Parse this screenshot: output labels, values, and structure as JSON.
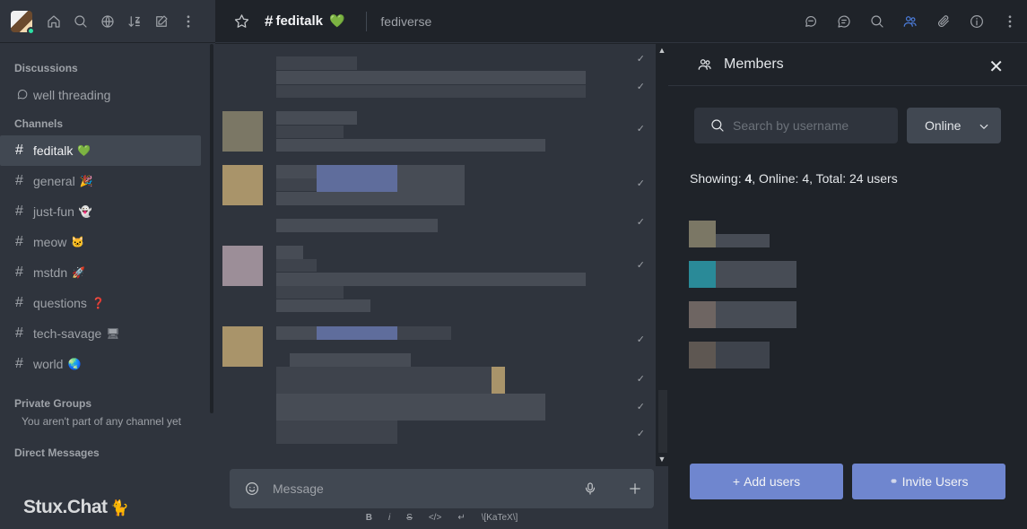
{
  "sidebar": {
    "sections": {
      "discussions": "Discussions",
      "channels": "Channels",
      "private_groups": "Private Groups",
      "direct_messages": "Direct Messages"
    },
    "discussion_item": "well threading",
    "channels": [
      {
        "label": "feditalk",
        "emoji": "💚",
        "active": true
      },
      {
        "label": "general",
        "emoji": "🎉"
      },
      {
        "label": "just-fun",
        "emoji": "👻"
      },
      {
        "label": "meow",
        "emoji": "🐱"
      },
      {
        "label": "mstdn",
        "emoji": "🚀"
      },
      {
        "label": "questions",
        "emoji": "❓"
      },
      {
        "label": "tech-savage",
        "emoji": "🖥"
      },
      {
        "label": "world",
        "emoji": "🌏"
      }
    ],
    "private_note": "You aren't part of any channel yet",
    "logo": "Stux.Chat",
    "logo_icon": "🐈"
  },
  "header": {
    "room_name": "feditalk",
    "room_emoji": "💚",
    "topic": "fediverse",
    "icons": [
      "discussion-icon",
      "threads-icon",
      "search-icon",
      "members-icon",
      "attachment-icon",
      "info-icon",
      "kebab-icon"
    ]
  },
  "composer": {
    "placeholder": "Message",
    "format_buttons": [
      "B",
      "i",
      "S",
      "</>",
      "↵",
      "\\[KaTeX\\]"
    ]
  },
  "members_panel": {
    "title": "Members",
    "search_placeholder": "Search by username",
    "status_value": "Online",
    "showing_label": "Showing:",
    "showing": "4",
    "online_label": ", Online:",
    "online": "4",
    "total_label": ", Total:",
    "total": "24 users",
    "add_users": "Add users",
    "invite_users": "Invite Users"
  },
  "colors": {
    "accent": "#4b7bd8",
    "button": "#6f86cf",
    "online": "#2de0a5"
  }
}
